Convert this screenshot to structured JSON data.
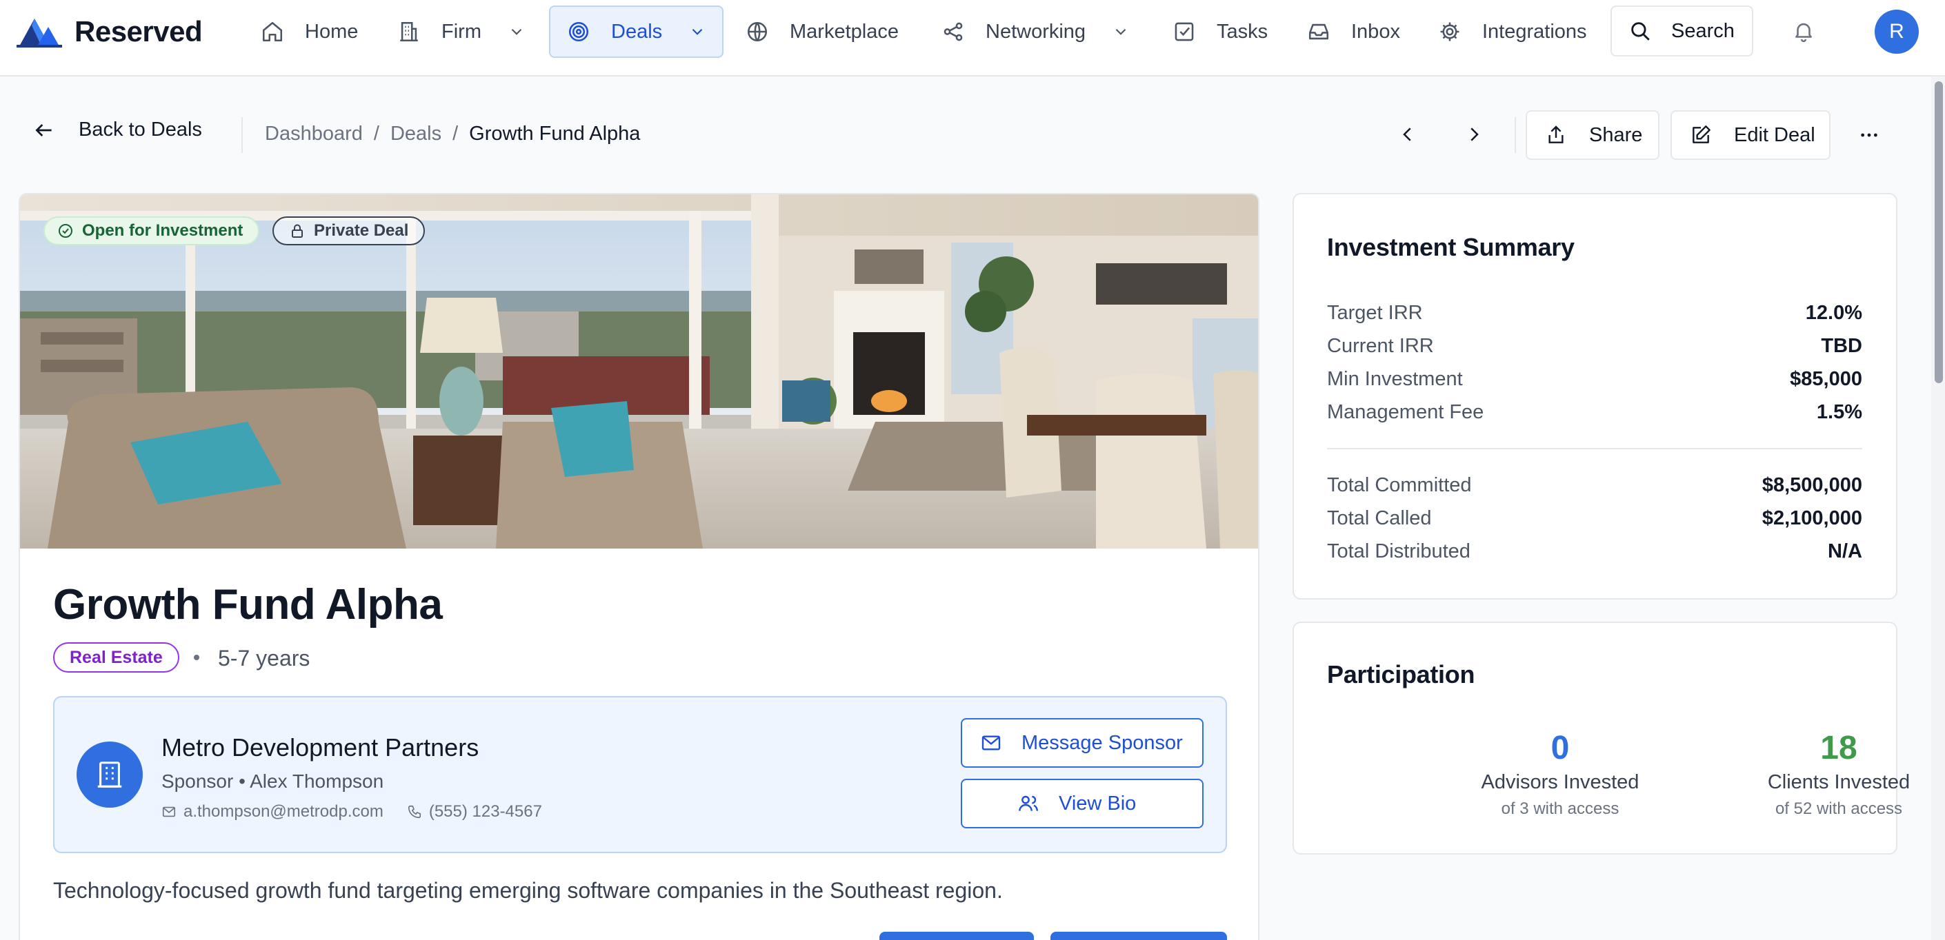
{
  "app": {
    "name": "Reserved",
    "avatar_initial": "R"
  },
  "nav": {
    "home": "Home",
    "firm": "Firm",
    "deals": "Deals",
    "marketplace": "Marketplace",
    "networking": "Networking",
    "tasks": "Tasks",
    "inbox": "Inbox",
    "integrations": "Integrations",
    "search": "Search"
  },
  "subheader": {
    "back_label": "Back to Deals",
    "breadcrumb": [
      "Dashboard",
      "Deals",
      "Growth Fund Alpha"
    ],
    "share_label": "Share",
    "edit_label": "Edit Deal"
  },
  "deal": {
    "status_badge": "Open for Investment",
    "visibility_badge": "Private Deal",
    "title": "Growth Fund Alpha",
    "asset_class": "Real Estate",
    "term": "5-7 years",
    "description": "Technology-focused growth fund targeting emerging software companies in the Southeast region."
  },
  "sponsor": {
    "name": "Metro Development Partners",
    "role": "Sponsor",
    "contact_name": "Alex Thompson",
    "email": "a.thompson@metrodp.com",
    "phone": "(555) 123-4567",
    "message_label": "Message Sponsor",
    "bio_label": "View Bio"
  },
  "summary": {
    "title": "Investment Summary",
    "rows": [
      {
        "label": "Target IRR",
        "value": "12.0%"
      },
      {
        "label": "Current IRR",
        "value": "TBD"
      },
      {
        "label": "Min Investment",
        "value": "$85,000"
      },
      {
        "label": "Management Fee",
        "value": "1.5%"
      }
    ],
    "totals": [
      {
        "label": "Total Committed",
        "value": "$8,500,000"
      },
      {
        "label": "Total Called",
        "value": "$2,100,000"
      },
      {
        "label": "Total Distributed",
        "value": "N/A"
      }
    ]
  },
  "participation": {
    "title": "Participation",
    "advisors": {
      "count": "0",
      "label": "Advisors Invested",
      "sub": "of 3 with access"
    },
    "clients": {
      "count": "18",
      "label": "Clients Invested",
      "sub": "of 52 with access"
    }
  },
  "colors": {
    "accent": "#2f6fe0",
    "advisors_count": "#2f6fe0",
    "clients_count": "#3f9a4a",
    "open_badge_bg": "#e8f7ea",
    "real_estate_tag": "#9333ea"
  },
  "icons": {
    "brand": "mountain-logo-icon",
    "home": "home-icon",
    "firm": "building-icon",
    "deals": "target-icon",
    "marketplace": "globe-icon",
    "networking": "share-nodes-icon",
    "tasks": "checkbox-icon",
    "inbox": "inbox-icon",
    "integrations": "gear-icon",
    "search": "search-icon",
    "notifications": "bell-icon"
  }
}
